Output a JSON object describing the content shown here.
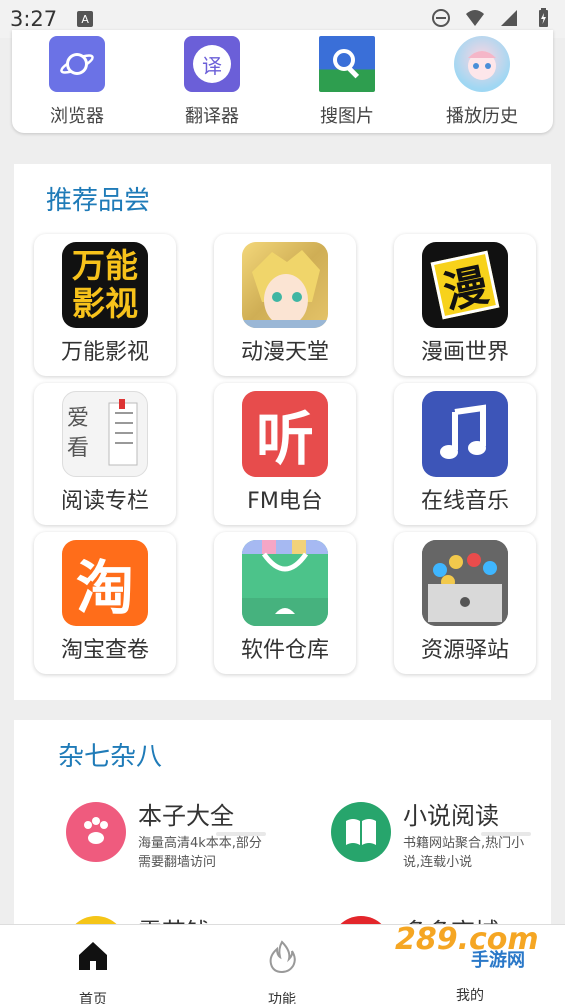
{
  "status_bar": {
    "time": "3:27",
    "notification_letter": "A"
  },
  "top_shortcuts": [
    {
      "label": "浏览器",
      "icon": "planet-icon"
    },
    {
      "label": "翻译器",
      "icon": "translate-icon",
      "glyph": "译"
    },
    {
      "label": "搜图片",
      "icon": "image-search-icon"
    },
    {
      "label": "播放历史",
      "icon": "anime-avatar-icon"
    }
  ],
  "recommend": {
    "title": "推荐品尝",
    "tiles": [
      {
        "label": "万能影视",
        "art_text": "万能影视"
      },
      {
        "label": "动漫天堂"
      },
      {
        "label": "漫画世界",
        "art_text": "漫"
      },
      {
        "label": "阅读专栏",
        "art_text": "爱看"
      },
      {
        "label": "FM电台",
        "art_text": "听"
      },
      {
        "label": "在线音乐"
      },
      {
        "label": "淘宝查卷",
        "art_text": "淘"
      },
      {
        "label": "软件仓库"
      },
      {
        "label": "资源驿站"
      }
    ]
  },
  "misc": {
    "title": "杂七杂八",
    "items": [
      {
        "title": "本子大全",
        "desc": "海量高清4k本本,部分需要翻墙访问"
      },
      {
        "title": "小说阅读",
        "desc": "书籍网站聚合,热门小说,连载小说"
      },
      {
        "title": "需艺钱",
        "desc": ""
      },
      {
        "title": "多多商城",
        "desc": ""
      }
    ]
  },
  "bottom_nav": [
    {
      "label": "首页",
      "active": true
    },
    {
      "label": "功能",
      "active": false
    },
    {
      "label": "我的",
      "active": false
    }
  ],
  "watermark": {
    "text": "289.com",
    "subtext": "手游网"
  },
  "colors": {
    "accent_title": "#1f7bb8",
    "background": "#eeeeee"
  }
}
